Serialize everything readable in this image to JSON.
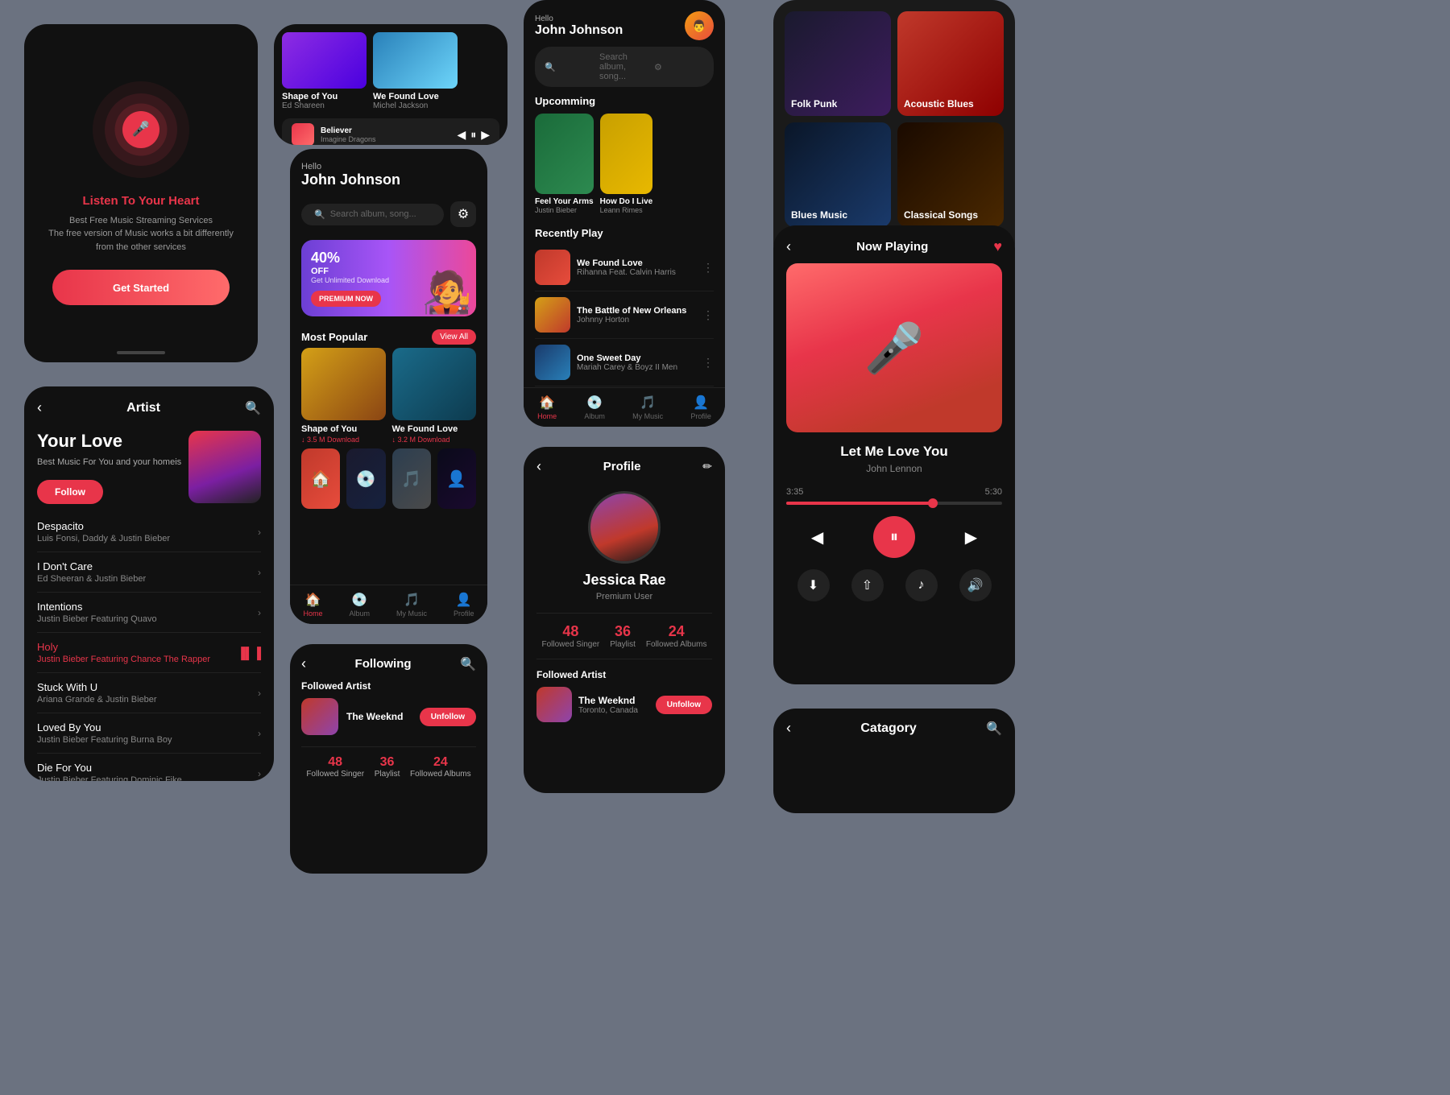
{
  "card_listen": {
    "title": "Listen To Your ",
    "title_highlight": "Heart",
    "desc_line1": "Best Free Music Streaming Services",
    "desc_line2": "The free version of Music works a bit differently",
    "desc_line3": "from the other services",
    "cta": "Get Started"
  },
  "card_artist": {
    "back": "‹",
    "title": "Artist",
    "artist_name": "Your Love",
    "artist_desc": "Best Music For You and your homeis",
    "follow_label": "Follow",
    "songs": [
      {
        "title": "Despacito",
        "artists": "Luis Fonsi, Daddy & Justin Bieber",
        "playing": false
      },
      {
        "title": "I Don't Care",
        "artists": "Ed Sheeran & Justin Bieber",
        "playing": false
      },
      {
        "title": "Intentions",
        "artists": "Justin Bieber Featuring Quavo",
        "playing": false
      },
      {
        "title": "Holy",
        "artists": "Justin Bieber Featuring Chance The Rapper",
        "playing": true
      },
      {
        "title": "Stuck With U",
        "artists": "Ariana Grande & Justin Bieber",
        "playing": false
      },
      {
        "title": "Loved By You",
        "artists": "Justin Bieber Featuring Burna Boy",
        "playing": false
      },
      {
        "title": "Die For You",
        "artists": "Justin Bieber Featuring Dominic Fike",
        "playing": false
      }
    ]
  },
  "card_home": {
    "hello": "Hello",
    "user_name": "John Johnson",
    "search_placeholder": "Search album, song...",
    "promo_percent": "40%",
    "promo_off": "OFF",
    "promo_desc": "Get Unlimited Download",
    "premium_btn": "PREMIUM NOW",
    "most_popular": "Most Popular",
    "view_all": "View All",
    "popular_songs": [
      {
        "title": "Shape of You",
        "download": "↓ 3.5 M Download"
      },
      {
        "title": "We Found Love",
        "download": "↓ 3.2 M Download"
      }
    ],
    "nav": [
      {
        "label": "Home",
        "icon": "🏠",
        "active": true
      },
      {
        "label": "Album",
        "icon": "💿",
        "active": false
      },
      {
        "label": "My Music",
        "icon": "🎵",
        "active": false
      },
      {
        "label": "Profile",
        "icon": "👤",
        "active": false
      }
    ]
  },
  "card_mini_player": {
    "songs": [
      {
        "title": "Shape of You",
        "artist": "Ed Shareen"
      },
      {
        "title": "We Found Love",
        "artist": "Michel Jackson"
      }
    ],
    "now_playing": {
      "title": "Believer",
      "artist": "Imagine Dragons"
    },
    "controls": [
      "◀",
      "⏸",
      "▶"
    ]
  },
  "card_search": {
    "user_name": "John Johnson",
    "search_placeholder": "Search album, song...",
    "upcoming_title": "Upcomming",
    "upcoming_cards": [
      {
        "title": "Feel Your Arms",
        "artist": "Justin Bieber"
      },
      {
        "title": "How Do I Live",
        "artist": "Leann Rimes"
      }
    ],
    "recently_title": "Recently Play",
    "recent_songs": [
      {
        "title": "We Found Love",
        "artist": "Rihanna Feat. Calvin Harris"
      },
      {
        "title": "The Battle of New Orleans",
        "artist": "Johnny Horton"
      },
      {
        "title": "One Sweet Day",
        "artist": "Mariah Carey & Boyz II Men"
      }
    ],
    "nav": [
      {
        "label": "Home",
        "icon": "🏠",
        "active": true
      },
      {
        "label": "Album",
        "icon": "💿",
        "active": false
      },
      {
        "label": "My Music",
        "icon": "🎵",
        "active": false
      },
      {
        "label": "Profile",
        "icon": "👤",
        "active": false
      }
    ]
  },
  "card_following": {
    "back": "‹",
    "title": "Following",
    "search_icon": "🔍",
    "followed_artist_label": "Followed Artist",
    "artist_name": "The Weeknd",
    "unfollow_btn": "Unfollow",
    "stats": [
      {
        "num": "48",
        "label": "Followed Singer"
      },
      {
        "num": "36",
        "label": "Playlist"
      },
      {
        "num": "24",
        "label": "Followed Albums"
      }
    ]
  },
  "card_profile": {
    "back": "‹",
    "title": "Profile",
    "edit_icon": "✏",
    "user_name": "Jessica Rae",
    "user_type": "Premium User",
    "stats": [
      {
        "num": "48",
        "label": "Followed Singer"
      },
      {
        "num": "36",
        "label": "Playlist"
      },
      {
        "num": "24",
        "label": "Followed  Albums"
      }
    ],
    "followed_title": "Followed Artist",
    "followed_artist": "The Weeknd",
    "followed_location": "Toronto, Canada",
    "unfollow_btn": "Unfollow"
  },
  "card_categories": {
    "items": [
      {
        "label": "Folk Punk"
      },
      {
        "label": "Acoustic Blues"
      },
      {
        "label": "Blues Music"
      },
      {
        "label": "Classical Songs"
      }
    ]
  },
  "card_now_playing": {
    "back": "‹",
    "title": "Now Playing",
    "song_title": "Let Me Love You",
    "artist": "John Lennon",
    "time_current": "3:35",
    "time_total": "5:30",
    "progress": 68,
    "actions": [
      "⬇",
      "⇧",
      "♪",
      "🔊"
    ]
  },
  "card_category_bottom": {
    "back": "‹",
    "title": "Catagory",
    "search_icon": "🔍"
  }
}
